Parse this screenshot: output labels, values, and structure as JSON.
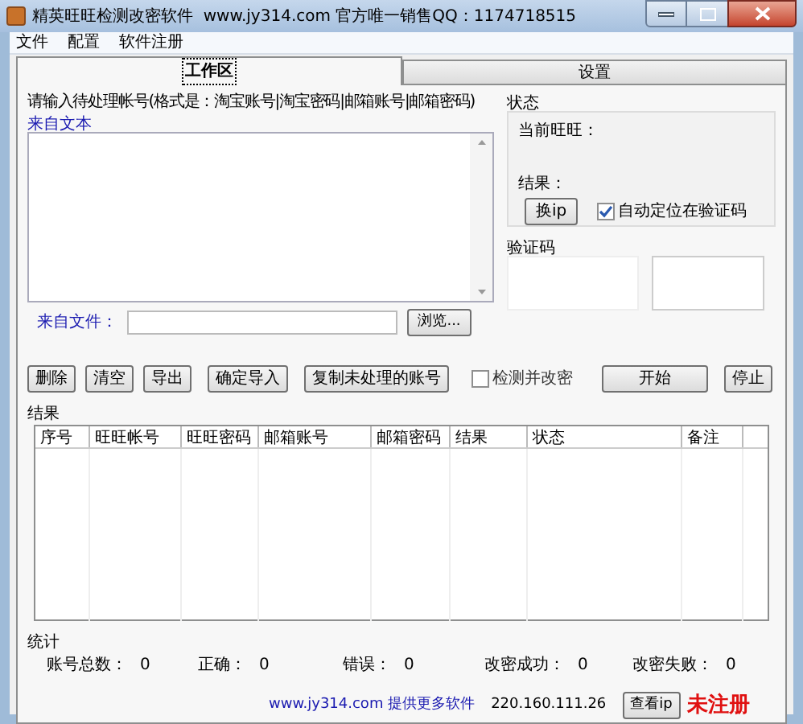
{
  "window": {
    "title": "精英旺旺检测改密软件  www.jy314.com 官方唯一销售QQ：1174718515"
  },
  "menu": [
    "文件",
    "配置",
    "软件注册"
  ],
  "tabs": [
    {
      "label": "工作区",
      "selected": true
    },
    {
      "label": "设置",
      "selected": false
    }
  ],
  "input": {
    "prompt": "请输入待处理帐号(格式是：淘宝账号|淘宝密码|邮箱账号|邮箱密码)",
    "from_text": "来自文本",
    "from_file": "来自文件：",
    "browse": "浏览..."
  },
  "status": {
    "title": "状态",
    "current": "当前旺旺：",
    "result": "结果：",
    "change_ip": "换ip",
    "auto_locate": {
      "label": "自动定位在验证码",
      "checked": true
    }
  },
  "captcha": {
    "title": "验证码"
  },
  "actions": [
    {
      "kind": "button",
      "label": "删除"
    },
    {
      "kind": "button",
      "label": "清空"
    },
    {
      "kind": "button",
      "label": "导出"
    },
    {
      "kind": "button",
      "label": "确定导入"
    },
    {
      "kind": "button",
      "label": "复制未处理的账号"
    },
    {
      "kind": "checkbox",
      "label": "检测并改密",
      "checked": false
    },
    {
      "kind": "wide",
      "label": "开始"
    },
    {
      "kind": "button",
      "label": "停止"
    }
  ],
  "results": {
    "title": "结果",
    "columns": [
      "序号",
      "旺旺帐号",
      "旺旺密码",
      "邮箱账号",
      "邮箱密码",
      "结果",
      "状态",
      "备注"
    ]
  },
  "stats": {
    "title": "统计",
    "items": [
      {
        "label": "账号总数：",
        "value": "0"
      },
      {
        "label": "正确：",
        "value": "0"
      },
      {
        "label": "错误：",
        "value": "0"
      },
      {
        "label": "改密成功：",
        "value": "0"
      },
      {
        "label": "改密失败：",
        "value": "0"
      }
    ]
  },
  "footer": {
    "link": "www.jy314.com 提供更多软件",
    "ip": "220.160.111.26",
    "check_ip": "查看ip",
    "registration": "未注册"
  }
}
